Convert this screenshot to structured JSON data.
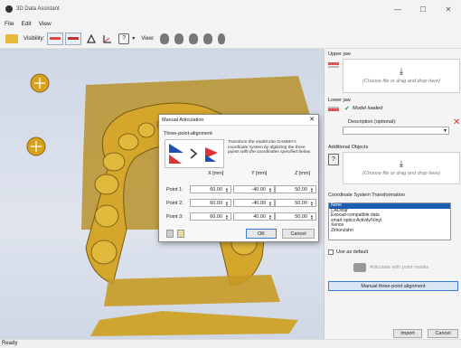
{
  "window": {
    "title": "3D Data Assistant",
    "minimize_glyph": "—",
    "maximize_glyph": "☐",
    "close_glyph": "✕"
  },
  "menu": {
    "items": [
      "File",
      "Edit",
      "View"
    ]
  },
  "toolbar": {
    "visibility_label": "Visibility:",
    "view_label": "View:",
    "help_glyph": "?",
    "dropdown_glyph": "▾",
    "icons": [
      "open-folder-icon",
      "visibility-upper-icon",
      "visibility-lower-icon",
      "tool-icon",
      "axes-icon",
      "help-icon",
      "head-front-icon",
      "head-back-icon",
      "head-left-icon",
      "head-right-icon",
      "head-top-icon"
    ]
  },
  "sidebar": {
    "upper_jaw": {
      "heading": "Upper jaw",
      "drop_text": "(Choose file or drag and drop here)",
      "drop_glyph": "⤓"
    },
    "lower_jaw": {
      "heading": "Lower jaw",
      "status": "Model loaded",
      "check_glyph": "✔",
      "description_label": "Description (optional):",
      "description_value": "",
      "remove_glyph": "✕",
      "select_glyph": "▾"
    },
    "additional": {
      "heading": "Additional Objects",
      "drop_text": "(Choose file or drag and drop here)",
      "drop_glyph": "⤓",
      "help_glyph": "?"
    },
    "coords": {
      "heading": "Coordinate System Transformation",
      "options": [
        "None",
        "CADstar",
        "Exocad-compatible data",
        "smart optics Activity/Vinyl",
        "Xenos",
        "Zirkonzahn"
      ],
      "selected": "None",
      "use_default_label": "Use as default",
      "articulate_label": "Articulate with point masks",
      "manual_button": "Manual three-point alignment"
    },
    "import_button": "Import",
    "cancel_button": "Cancel"
  },
  "dialog": {
    "title": "Manual Articulation",
    "close_glyph": "✕",
    "group_label": "Three-point-alignment",
    "description": "Transform the model into GAMMA's coordinate system by digitizing the three points with the coordinates specified below.",
    "columns": [
      "X [mm]",
      "Y [mm]",
      "Z [mm]"
    ],
    "spin_up": "▲",
    "spin_down": "▼",
    "rows": [
      {
        "label": "Point 1:",
        "x": "60.00",
        "y": "-40.00",
        "z": "50.00"
      },
      {
        "label": "Point 2:",
        "x": "60.00",
        "y": "-40.00",
        "z": "50.00"
      },
      {
        "label": "Point 3:",
        "x": "60.00",
        "y": "40.00",
        "z": "50.00"
      }
    ],
    "ok_button": "OK",
    "cancel_button": "Cancel"
  },
  "status": {
    "text": "Ready"
  },
  "colors": {
    "accent": "#1a5fb4",
    "model_gold": "#c9a227",
    "viewport_bg": "#d7dde8",
    "ok_green": "#2e9e2e",
    "remove_red": "#d33333"
  }
}
